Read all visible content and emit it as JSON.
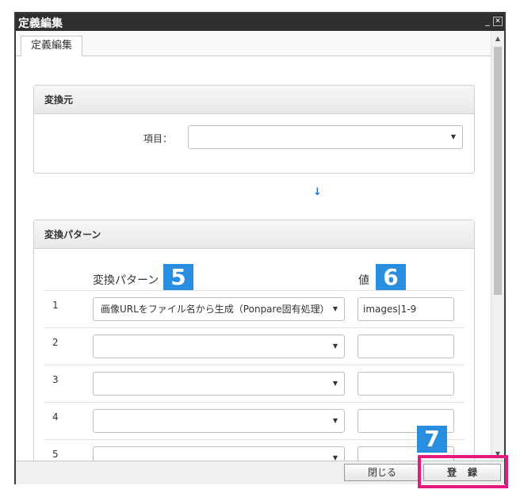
{
  "window": {
    "title": "定義編集",
    "minimize_glyph": "_",
    "close_glyph": "✕"
  },
  "tabs": [
    {
      "label": "定義編集"
    }
  ],
  "source_panel": {
    "title": "変換元",
    "field_label": "項目：",
    "field_value": ""
  },
  "arrow_glyph": "↓",
  "pattern_panel": {
    "title": "変換パターン",
    "col_pattern": "変換パターン",
    "col_value": "値",
    "badge_pattern": "5",
    "badge_value": "6",
    "rows": [
      {
        "num": "1",
        "pattern": "画像URLをファイル名から生成（Ponpare固有処理）",
        "value": "images|1-9"
      },
      {
        "num": "2",
        "pattern": "",
        "value": ""
      },
      {
        "num": "3",
        "pattern": "",
        "value": ""
      },
      {
        "num": "4",
        "pattern": "",
        "value": ""
      },
      {
        "num": "5",
        "pattern": "",
        "value": ""
      }
    ]
  },
  "footer": {
    "close_label": "閉じる",
    "register_label": "登録",
    "badge_register": "7"
  },
  "colors": {
    "accent_badge": "#2a8ee0",
    "highlight": "#e6197f",
    "titlebar": "#2f2f2f"
  },
  "icons": {
    "dropdown": "chevron-down-icon",
    "arrow": "arrow-down-icon"
  }
}
